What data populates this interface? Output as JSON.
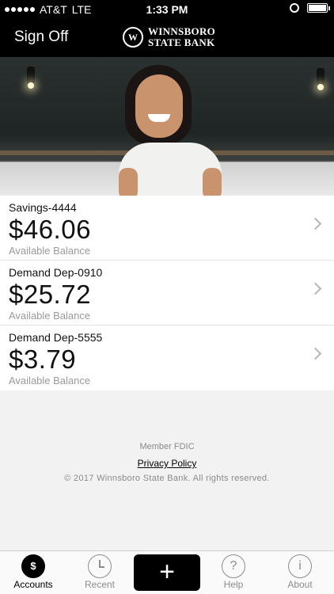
{
  "status_bar": {
    "carrier": "AT&T",
    "network": "LTE",
    "time": "1:33 PM"
  },
  "header": {
    "sign_off": "Sign Off",
    "brand_line1": "WINNSBORO",
    "brand_line2": "STATE BANK",
    "logo_mark": "W"
  },
  "accounts": [
    {
      "name": "Savings-4444",
      "balance": "$46.06",
      "label": "Available Balance"
    },
    {
      "name": "Demand Dep-0910",
      "balance": "$25.72",
      "label": "Available Balance"
    },
    {
      "name": "Demand Dep-5555",
      "balance": "$3.79",
      "label": "Available Balance"
    }
  ],
  "footer": {
    "member": "Member FDIC",
    "privacy": "Privacy Policy",
    "copyright": "© 2017 Winnsboro State Bank. All rights reserved."
  },
  "tabs": {
    "accounts": {
      "label": "Accounts",
      "icon": "dollar-icon",
      "glyph": "$"
    },
    "recent": {
      "label": "Recent",
      "icon": "clock-icon"
    },
    "add": {
      "glyph": "+",
      "icon": "plus-icon"
    },
    "help": {
      "label": "Help",
      "icon": "question-icon",
      "glyph": "?"
    },
    "about": {
      "label": "About",
      "icon": "info-icon",
      "glyph": "i"
    }
  }
}
